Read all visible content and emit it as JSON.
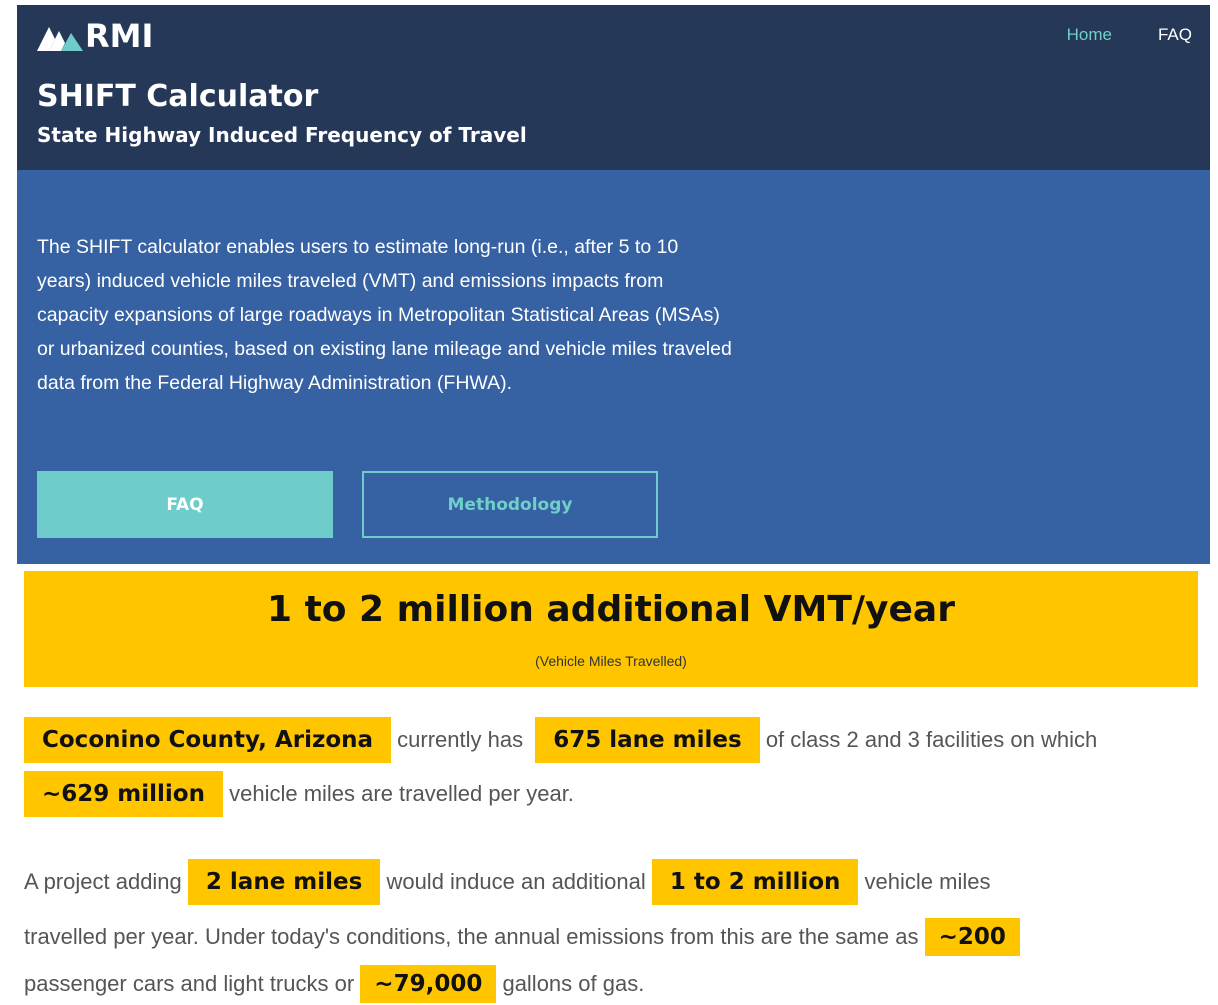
{
  "header": {
    "logo_text": "RMI",
    "title": "SHIFT Calculator",
    "subtitle": "State Highway Induced Frequency of Travel",
    "nav": {
      "home": "Home",
      "faq": "FAQ"
    }
  },
  "hero": {
    "description": "The SHIFT calculator enables users to estimate long-run (i.e., after 5 to 10 years) induced vehicle miles traveled (VMT) and emissions impacts from capacity expansions of large roadways in Metropolitan Statistical Areas (MSAs) or urbanized counties, based on existing lane mileage and vehicle miles traveled data from the Federal Highway Administration (FHWA).",
    "faq_button": "FAQ",
    "methodology_button": "Methodology"
  },
  "result": {
    "headline": "1 to 2 million additional VMT/year",
    "subtext": "(Vehicle Miles Travelled)"
  },
  "summary": {
    "county": "Coconino County, Arizona",
    "t1": "currently has",
    "lane_miles": "675 lane miles",
    "t2": "of class 2 and 3 facilities on which",
    "vmt": "~629 million",
    "t3": "vehicle miles are travelled per year."
  },
  "impact": {
    "t1": "A project adding",
    "added_lane_miles": "2 lane miles",
    "t2": "would induce an additional",
    "induced_vmt": "1 to 2 million",
    "t3": "vehicle miles",
    "t4": "travelled per year. Under today's conditions, the annual emissions from this are the same as",
    "cars": "~200",
    "t5": "passenger cars and light trucks or",
    "gallons": "~79,000",
    "t6": "gallons of gas."
  },
  "colors": {
    "header_bg": "#253858",
    "hero_bg": "#3661a3",
    "accent_teal": "#6ecdca",
    "highlight_yellow": "#ffc600"
  }
}
